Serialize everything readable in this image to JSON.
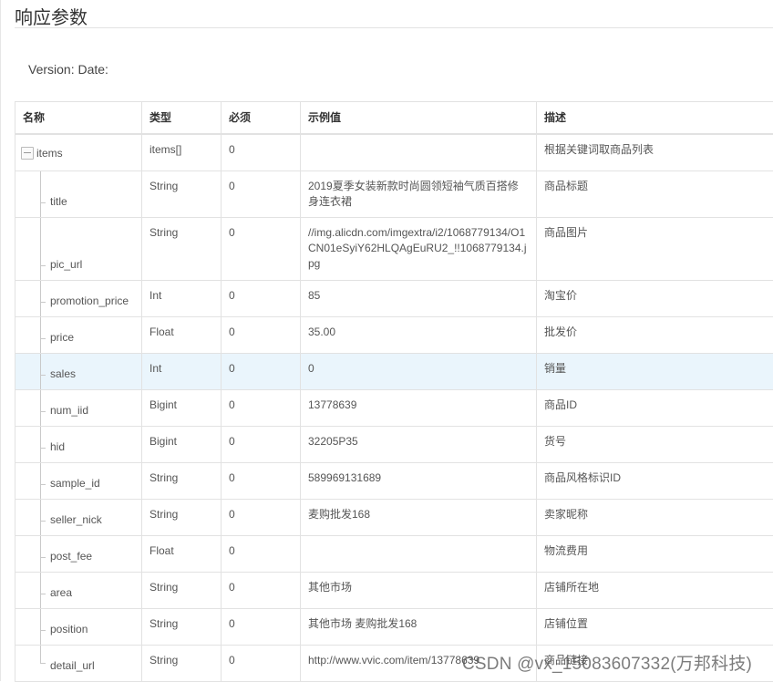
{
  "section_title": "响应参数",
  "version_line": "Version: Date:",
  "table": {
    "headers": [
      "名称",
      "类型",
      "必须",
      "示例值",
      "描述"
    ],
    "parent": {
      "name": "items",
      "type": "items[]",
      "required": "0",
      "example": "",
      "desc": "根据关键词取商品列表",
      "expanded": true
    },
    "rows": [
      {
        "name": "title",
        "type": "String",
        "required": "0",
        "example": "2019夏季女装新款时尚圆领短袖气质百搭修身连衣裙",
        "desc": "商品标题"
      },
      {
        "name": "pic_url",
        "type": "String",
        "required": "0",
        "example": "//img.alicdn.com/imgextra/i2/1068779134/O1CN01eSyiY62HLQAgEuRU2_!!1068779134.jpg",
        "desc": "商品图片"
      },
      {
        "name": "promotion_price",
        "type": "Int",
        "required": "0",
        "example": "85",
        "desc": "淘宝价"
      },
      {
        "name": "price",
        "type": "Float",
        "required": "0",
        "example": "35.00",
        "desc": "批发价"
      },
      {
        "name": "sales",
        "type": "Int",
        "required": "0",
        "example": "0",
        "desc": "销量",
        "highlighted": true
      },
      {
        "name": "num_iid",
        "type": "Bigint",
        "required": "0",
        "example": "13778639",
        "desc": "商品ID"
      },
      {
        "name": "hid",
        "type": "Bigint",
        "required": "0",
        "example": "32205P35",
        "desc": "货号"
      },
      {
        "name": "sample_id",
        "type": "String",
        "required": "0",
        "example": "589969131689",
        "desc": "商品风格标识ID"
      },
      {
        "name": "seller_nick",
        "type": "String",
        "required": "0",
        "example": "麦购批发168",
        "desc": "卖家昵称"
      },
      {
        "name": "post_fee",
        "type": "Float",
        "required": "0",
        "example": "",
        "desc": "物流费用"
      },
      {
        "name": "area",
        "type": "String",
        "required": "0",
        "example": "其他市场",
        "desc": "店铺所在地"
      },
      {
        "name": "position",
        "type": "String",
        "required": "0",
        "example": "其他市场 麦购批发168",
        "desc": "店铺位置"
      },
      {
        "name": "detail_url",
        "type": "String",
        "required": "0",
        "example": "http://www.vvic.com/item/13778639",
        "desc": "商品链接"
      }
    ]
  },
  "watermark": "CSDN @vx_15083607332(万邦科技)"
}
